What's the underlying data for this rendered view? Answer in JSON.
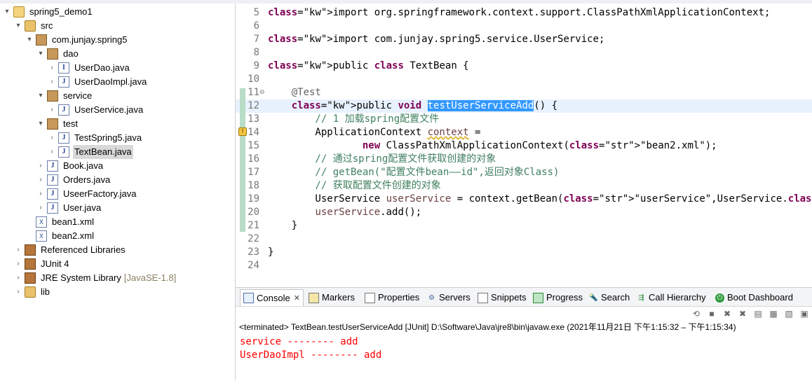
{
  "explorer": {
    "items": [
      {
        "label": "spring5_demo1",
        "arrow": "▾",
        "icon": "project-icon"
      },
      {
        "label": "src",
        "arrow": "▾",
        "icon": "source-folder-icon"
      },
      {
        "label": "com.junjay.spring5",
        "arrow": "▾",
        "icon": "package-icon"
      },
      {
        "label": "dao",
        "arrow": "▾",
        "icon": "package-icon"
      },
      {
        "label": "UserDao.java",
        "arrow": "›",
        "icon": "java-interface-icon"
      },
      {
        "label": "UserDaoImpl.java",
        "arrow": "›",
        "icon": "java-file-icon"
      },
      {
        "label": "service",
        "arrow": "▾",
        "icon": "package-icon"
      },
      {
        "label": "UserService.java",
        "arrow": "›",
        "icon": "java-file-icon"
      },
      {
        "label": "test",
        "arrow": "▾",
        "icon": "package-icon"
      },
      {
        "label": "TestSpring5.java",
        "arrow": "›",
        "icon": "java-file-icon"
      },
      {
        "label": "TextBean.java",
        "arrow": "›",
        "icon": "java-file-icon"
      },
      {
        "label": "Book.java",
        "arrow": "›",
        "icon": "java-file-icon"
      },
      {
        "label": "Orders.java",
        "arrow": "›",
        "icon": "java-file-icon"
      },
      {
        "label": "UseerFactory.java",
        "arrow": "›",
        "icon": "java-file-icon"
      },
      {
        "label": "User.java",
        "arrow": "›",
        "icon": "java-file-icon"
      },
      {
        "label": "bean1.xml",
        "arrow": "",
        "icon": "xml-file-icon"
      },
      {
        "label": "bean2.xml",
        "arrow": "",
        "icon": "xml-file-icon"
      },
      {
        "label": "Referenced Libraries",
        "arrow": "›",
        "icon": "library-icon"
      },
      {
        "label": "JUnit 4",
        "arrow": "›",
        "icon": "library-icon"
      },
      {
        "label": "JRE System Library",
        "suffix": "[JavaSE-1.8]",
        "arrow": "›",
        "icon": "library-icon"
      },
      {
        "label": "lib",
        "arrow": "›",
        "icon": "folder-icon"
      }
    ]
  },
  "editor": {
    "lines": [
      {
        "n": "5",
        "text": "import org.springframework.context.support.ClassPathXmlApplicationContext;"
      },
      {
        "n": "6",
        "text": ""
      },
      {
        "n": "7",
        "text": "import com.junjay.spring5.service.UserService;"
      },
      {
        "n": "8",
        "text": ""
      },
      {
        "n": "9",
        "text": "public class TextBean {"
      },
      {
        "n": "10",
        "text": ""
      },
      {
        "n": "11",
        "text": "    @Test"
      },
      {
        "n": "12",
        "text": "    public void testUserServiceAdd() {"
      },
      {
        "n": "13",
        "text": "        // 1 加载spring配置文件"
      },
      {
        "n": "14",
        "text": "        ApplicationContext context ="
      },
      {
        "n": "15",
        "text": "                new ClassPathXmlApplicationContext(\"bean2.xml\");"
      },
      {
        "n": "16",
        "text": "        // 通过spring配置文件获取创建的对象"
      },
      {
        "n": "17",
        "text": "        // getBean(\"配置文件bean——id\",返回对象Class)"
      },
      {
        "n": "18",
        "text": "        // 获取配置文件创建的对象"
      },
      {
        "n": "19",
        "text": "        UserService userService = context.getBean(\"userService\",UserService.class);"
      },
      {
        "n": "20",
        "text": "        userService.add();"
      },
      {
        "n": "21",
        "text": "    }"
      },
      {
        "n": "22",
        "text": ""
      },
      {
        "n": "23",
        "text": "}"
      },
      {
        "n": "24",
        "text": ""
      }
    ]
  },
  "views": {
    "tabs": [
      {
        "label": "Console",
        "icon": "console-icon",
        "active": true
      },
      {
        "label": "Markers",
        "icon": "markers-icon"
      },
      {
        "label": "Properties",
        "icon": "properties-icon"
      },
      {
        "label": "Servers",
        "icon": "servers-icon"
      },
      {
        "label": "Snippets",
        "icon": "snippets-icon"
      },
      {
        "label": "Progress",
        "icon": "progress-icon"
      },
      {
        "label": "Search",
        "icon": "search-icon"
      },
      {
        "label": "Call Hierarchy",
        "icon": "call-hierarchy-icon"
      },
      {
        "label": "Boot Dashboard",
        "icon": "boot-dashboard-icon"
      }
    ],
    "status": "<terminated> TextBean.testUserServiceAdd [JUnit] D:\\Software\\Java\\jre8\\bin\\javaw.exe  (2021年11月21日 下午1:15:32 – 下午1:15:34)",
    "output": [
      "service -------- add",
      "UserDaoImpl -------- add"
    ]
  },
  "colors": {
    "keyword": "#7f0055",
    "comment": "#3f7f5f",
    "string": "#2a00ff",
    "selection": "#3399ff",
    "error_output": "#ff0000"
  }
}
